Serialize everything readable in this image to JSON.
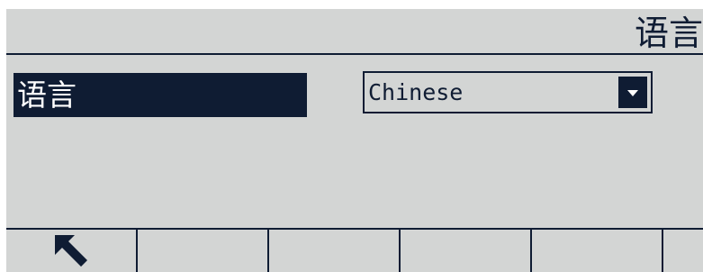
{
  "header": {
    "title": "语言"
  },
  "settings": {
    "language_label": "语言",
    "language_value": "Chinese"
  },
  "softkeys": [
    {
      "icon": "back-arrow-icon"
    },
    {
      "icon": ""
    },
    {
      "icon": ""
    },
    {
      "icon": ""
    },
    {
      "icon": ""
    },
    {
      "icon": ""
    }
  ],
  "colors": {
    "background": "#d3d5d4",
    "foreground": "#0f1c33",
    "highlight_text": "#ffffff"
  }
}
